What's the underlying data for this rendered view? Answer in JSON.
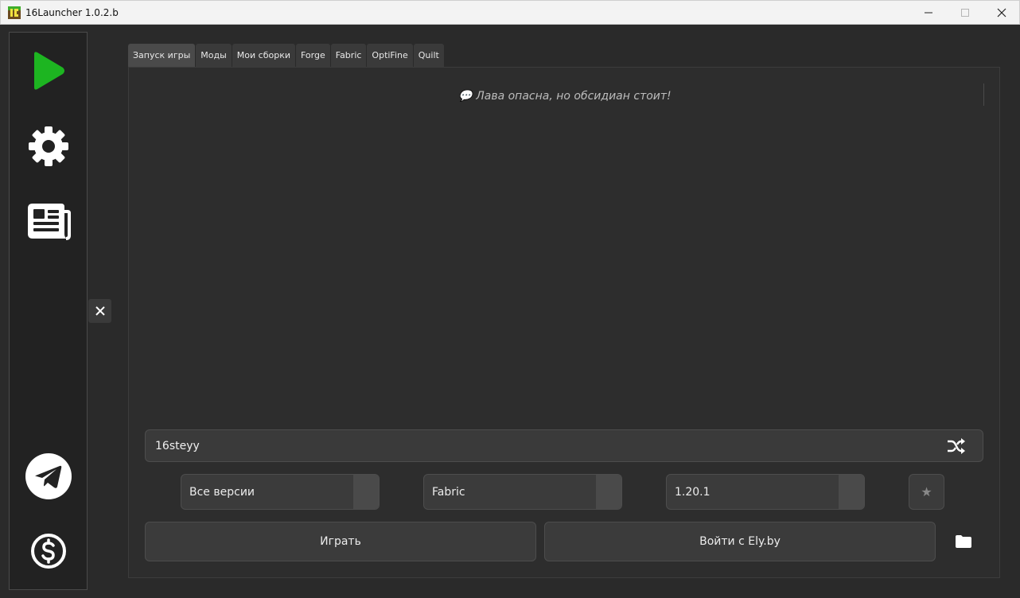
{
  "window": {
    "title": "16Launcher 1.0.2.b",
    "controls": [
      "minimize-icon",
      "maximize-icon",
      "close-icon"
    ]
  },
  "sidebar": {
    "items": [
      {
        "icon": "play-icon",
        "color": "#1db521"
      },
      {
        "icon": "gear-icon"
      },
      {
        "icon": "news-icon"
      },
      {
        "icon": "telegram-icon"
      },
      {
        "icon": "dollar-icon"
      }
    ]
  },
  "tabs": [
    {
      "label": "Запуск игры",
      "active": true
    },
    {
      "label": "Моды"
    },
    {
      "label": "Мои сборки"
    },
    {
      "label": "Forge"
    },
    {
      "label": "Fabric"
    },
    {
      "label": "OptiFine"
    },
    {
      "label": "Quilt"
    }
  ],
  "main": {
    "quote": "💬 Лава опасна, но обсидиан стоит!",
    "nickname": "16steyy",
    "version_filter": "Все версии",
    "loader": "Fabric",
    "version": "1.20.1",
    "play_label": "Играть",
    "login_label": "Войти с Ely.by"
  }
}
